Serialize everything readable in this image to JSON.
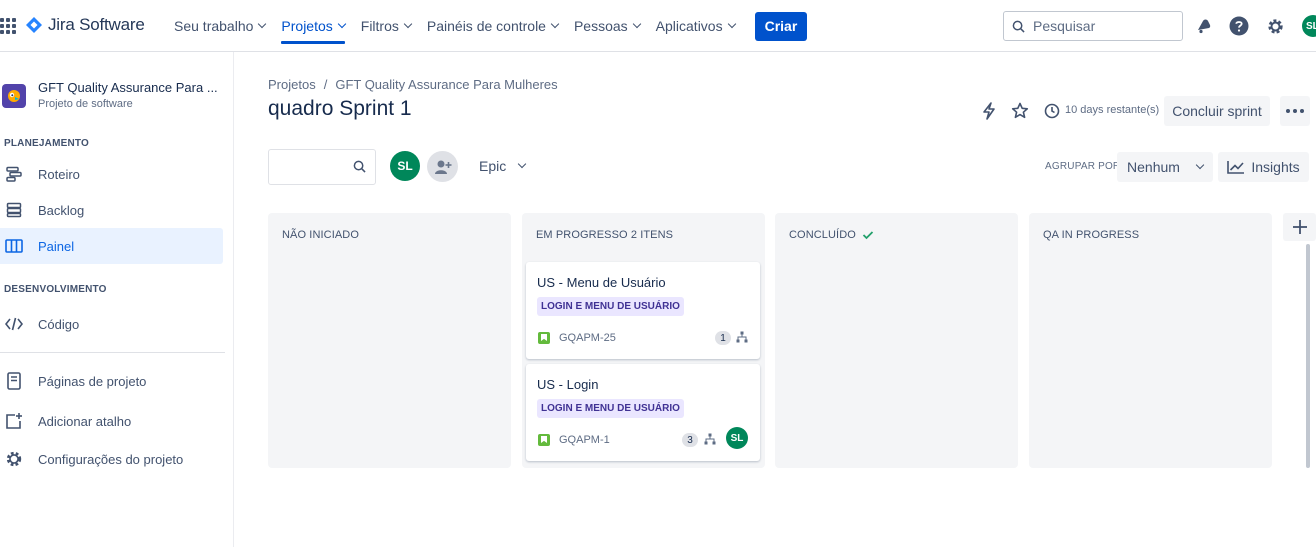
{
  "topnav": {
    "product": "Jira Software",
    "items": [
      {
        "label": "Seu trabalho",
        "active": false
      },
      {
        "label": "Projetos",
        "active": true
      },
      {
        "label": "Filtros",
        "active": false
      },
      {
        "label": "Painéis de controle",
        "active": false
      },
      {
        "label": "Pessoas",
        "active": false
      },
      {
        "label": "Aplicativos",
        "active": false
      }
    ],
    "create_label": "Criar",
    "search_placeholder": "Pesquisar",
    "user_initials": "SL"
  },
  "sidebar": {
    "project_name": "GFT Quality Assurance Para ...",
    "project_type": "Projeto de software",
    "planning_title": "PLANEJAMENTO",
    "planning_items": [
      {
        "label": "Roteiro",
        "icon": "roadmap-icon"
      },
      {
        "label": "Backlog",
        "icon": "backlog-icon"
      },
      {
        "label": "Painel",
        "icon": "board-icon",
        "active": true
      }
    ],
    "dev_title": "DESENVOLVIMENTO",
    "dev_items": [
      {
        "label": "Código",
        "icon": "code-icon"
      }
    ],
    "bottom_items": [
      {
        "label": "Páginas de projeto",
        "icon": "page-icon"
      },
      {
        "label": "Adicionar atalho",
        "icon": "add-shortcut-icon"
      },
      {
        "label": "Configurações do projeto",
        "icon": "gear-icon"
      }
    ]
  },
  "main": {
    "breadcrumb": [
      "Projetos",
      "/",
      "GFT Quality Assurance Para Mulheres"
    ],
    "title": "quadro Sprint 1",
    "days_remaining": "10 days restante(s)",
    "complete_sprint": "Concluir sprint",
    "filter_avatar": "SL",
    "epic_filter": "Epic",
    "group_by_label": "AGRUPAR POR",
    "group_by_value": "Nenhum",
    "insights": "Insights"
  },
  "board": {
    "columns": [
      {
        "title": "NÃO INICIADO"
      },
      {
        "title": "EM PROGRESSO 2 ITENS"
      },
      {
        "title": "CONCLUÍDO"
      },
      {
        "title": "QA IN PROGRESS"
      }
    ],
    "cards": [
      {
        "title": "US - Menu de Usuário",
        "epic": "LOGIN E MENU DE USUÁRIO",
        "key": "GQAPM-25",
        "points": "1"
      },
      {
        "title": "US - Login",
        "epic": "LOGIN E MENU DE USUÁRIO",
        "key": "GQAPM-1",
        "points": "3",
        "assignee": "SL"
      }
    ]
  },
  "colors": {
    "primary": "#0052cc",
    "epic_bg": "#eae6ff",
    "epic_text": "#403294",
    "avatar": "#00875a",
    "story": "#63ba3c"
  }
}
